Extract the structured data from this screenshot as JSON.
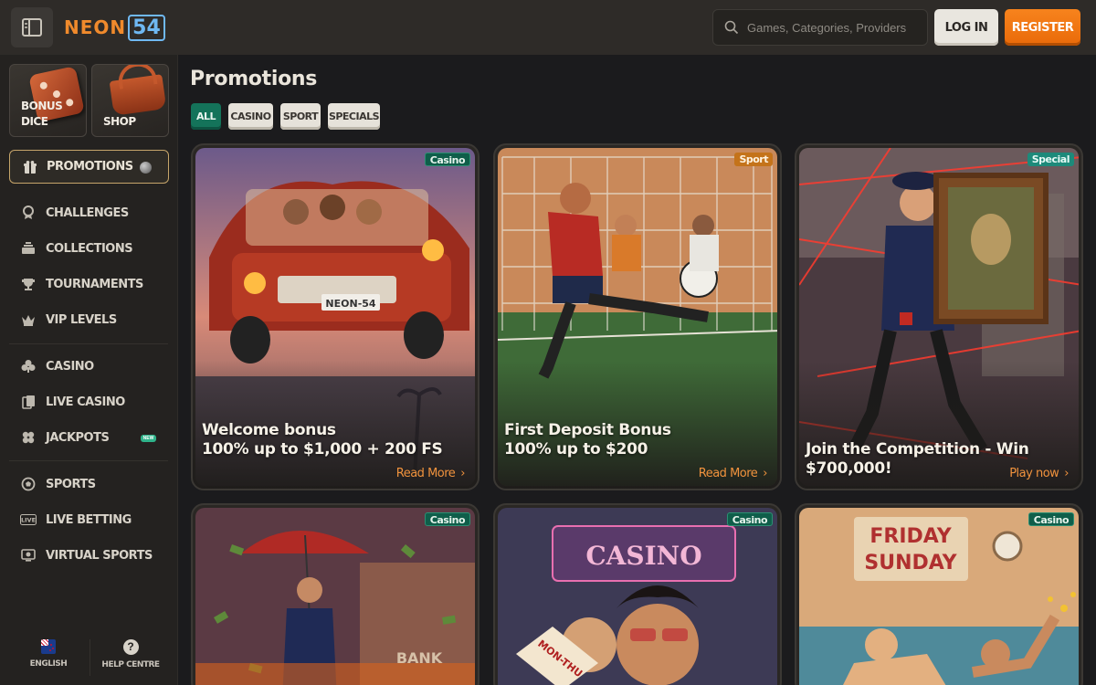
{
  "header": {
    "logo_part1": "NEON",
    "logo_part2": "54",
    "search_placeholder": "Games, Categories, Providers",
    "login_label": "LOG IN",
    "register_label": "REGISTER"
  },
  "sidebar": {
    "tiles": [
      {
        "label_line1": "BONUS",
        "label_line2": "DICE"
      },
      {
        "label_line1": "SHOP",
        "label_line2": ""
      }
    ],
    "active_item": "PROMOTIONS",
    "groups": [
      [
        {
          "label": "CHALLENGES",
          "icon": "medal-icon"
        },
        {
          "label": "COLLECTIONS",
          "icon": "collection-icon"
        },
        {
          "label": "TOURNAMENTS",
          "icon": "trophy-icon"
        },
        {
          "label": "VIP LEVELS",
          "icon": "crown-icon"
        }
      ],
      [
        {
          "label": "CASINO",
          "icon": "club-icon"
        },
        {
          "label": "LIVE CASINO",
          "icon": "live-cards-icon"
        },
        {
          "label": "JACKPOTS",
          "icon": "clover-icon",
          "badge": "NEW"
        }
      ],
      [
        {
          "label": "SPORTS",
          "icon": "football-icon"
        },
        {
          "label": "LIVE BETTING",
          "icon": "live-icon"
        },
        {
          "label": "VIRTUAL SPORTS",
          "icon": "virtual-sports-icon"
        }
      ]
    ],
    "footer": {
      "language": "ENGLISH",
      "help": "HELP CENTRE"
    }
  },
  "main": {
    "title": "Promotions",
    "filters": [
      "ALL",
      "CASINO",
      "SPORT",
      "SPECIALS"
    ],
    "active_filter": "ALL",
    "cards": [
      {
        "badge": "Casino",
        "line1": "Welcome bonus",
        "line2": "100% up to $1,000 + 200 FS",
        "link": "Read More"
      },
      {
        "badge": "Sport",
        "line1": "First Deposit Bonus",
        "line2": "100% up to $200",
        "link": "Read More"
      },
      {
        "badge": "Special",
        "line1": "",
        "line2": "Join the Competition - Win $700,000!",
        "link": "Play now"
      },
      {
        "badge": "Casino"
      },
      {
        "badge": "Casino"
      },
      {
        "badge": "Casino"
      }
    ],
    "art_text": {
      "plate": "NEON-54",
      "bank": "BANK",
      "casino_sign": "CASINO",
      "ticket": "MON-THU",
      "friday": "FRIDAY",
      "sunday": "SUNDAY"
    }
  },
  "colors": {
    "accent": "#f08a2c",
    "filter_active": "#14735a",
    "topbar": "#2e2b28",
    "sidebar": "#242220"
  }
}
